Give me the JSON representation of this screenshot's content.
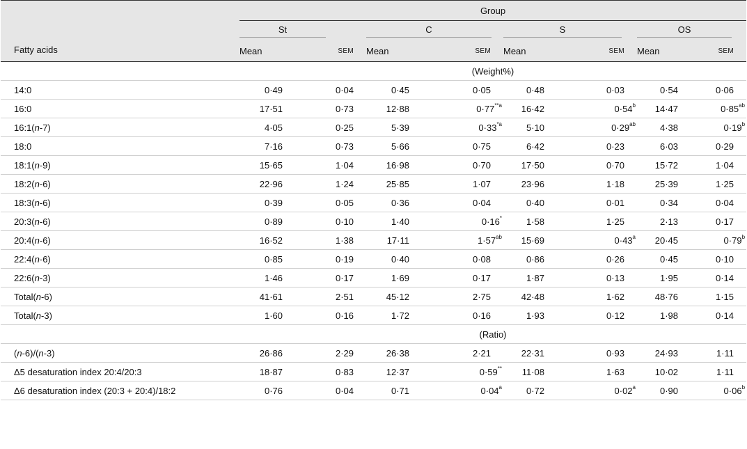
{
  "header": {
    "group_label": "Group",
    "row_label": "Fatty acids",
    "groups": [
      "St",
      "C",
      "S",
      "OS"
    ],
    "mean_label": "Mean",
    "sem_label": "SEM"
  },
  "sections": {
    "weight": "(Weight%)",
    "ratio": "(Ratio)"
  },
  "rows_weight": [
    {
      "name": "14:0",
      "values": [
        "0·49",
        "0·04",
        "0·45",
        "0·05",
        "0·48",
        "0·03",
        "0·54",
        "0·06"
      ],
      "sup": [
        "",
        "",
        "",
        "",
        "",
        "",
        "",
        ""
      ]
    },
    {
      "name": "16:0",
      "values": [
        "17·51",
        "0·73",
        "12·88",
        "0·77",
        "16·42",
        "0·54",
        "14·47",
        "0·85"
      ],
      "sup": [
        "",
        "",
        "",
        "**a",
        "",
        "b",
        "",
        "ab"
      ]
    },
    {
      "name_pre": "16:1(",
      "name_it": "n",
      "name_post": "-7)",
      "values": [
        "4·05",
        "0·25",
        "5·39",
        "0·33",
        "5·10",
        "0·29",
        "4·38",
        "0·19"
      ],
      "sup": [
        "",
        "",
        "",
        "*a",
        "",
        "ab",
        "",
        "b"
      ]
    },
    {
      "name": "18:0",
      "values": [
        "7·16",
        "0·73",
        "5·66",
        "0·75",
        "6·42",
        "0·23",
        "6·03",
        "0·29"
      ],
      "sup": [
        "",
        "",
        "",
        "",
        "",
        "",
        "",
        ""
      ]
    },
    {
      "name_pre": "18:1(",
      "name_it": "n",
      "name_post": "-9)",
      "values": [
        "15·65",
        "1·04",
        "16·98",
        "0·70",
        "17·50",
        "0·70",
        "15·72",
        "1·04"
      ],
      "sup": [
        "",
        "",
        "",
        "",
        "",
        "",
        "",
        ""
      ]
    },
    {
      "name_pre": "18:2(",
      "name_it": "n",
      "name_post": "-6)",
      "values": [
        "22·96",
        "1·24",
        "25·85",
        "1·07",
        "23·96",
        "1·18",
        "25·39",
        "1·25"
      ],
      "sup": [
        "",
        "",
        "",
        "",
        "",
        "",
        "",
        ""
      ]
    },
    {
      "name_pre": "18:3(",
      "name_it": "n",
      "name_post": "-6)",
      "values": [
        "0·39",
        "0·05",
        "0·36",
        "0·04",
        "0·40",
        "0·01",
        "0·34",
        "0·04"
      ],
      "sup": [
        "",
        "",
        "",
        "",
        "",
        "",
        "",
        ""
      ]
    },
    {
      "name_pre": "20:3(",
      "name_it": "n",
      "name_post": "-6)",
      "values": [
        "0·89",
        "0·10",
        "1·40",
        "0·16",
        "1·58",
        "1·25",
        "2·13",
        "0·17"
      ],
      "sup": [
        "",
        "",
        "",
        "*",
        "",
        "",
        "",
        ""
      ]
    },
    {
      "name_pre": "20:4(",
      "name_it": "n",
      "name_post": "-6)",
      "values": [
        "16·52",
        "1·38",
        "17·11",
        "1·57",
        "15·69",
        "0·43",
        "20·45",
        "0·79"
      ],
      "sup": [
        "",
        "",
        "",
        "ab",
        "",
        "a",
        "",
        "b"
      ]
    },
    {
      "name_pre": "22:4(",
      "name_it": "n",
      "name_post": "-6)",
      "values": [
        "0·85",
        "0·19",
        "0·40",
        "0·08",
        "0·86",
        "0·26",
        "0·45",
        "0·10"
      ],
      "sup": [
        "",
        "",
        "",
        "",
        "",
        "",
        "",
        ""
      ]
    },
    {
      "name_pre": "22:6(",
      "name_it": "n",
      "name_post": "-3)",
      "values": [
        "1·46",
        "0·17",
        "1·69",
        "0·17",
        "1·87",
        "0·13",
        "1·95",
        "0·14"
      ],
      "sup": [
        "",
        "",
        "",
        "",
        "",
        "",
        "",
        ""
      ]
    },
    {
      "name_pre": "Total(",
      "name_it": "n",
      "name_post": "-6)",
      "values": [
        "41·61",
        "2·51",
        "45·12",
        "2·75",
        "42·48",
        "1·62",
        "48·76",
        "1·15"
      ],
      "sup": [
        "",
        "",
        "",
        "",
        "",
        "",
        "",
        ""
      ]
    },
    {
      "name_pre": "Total(",
      "name_it": "n",
      "name_post": "-3)",
      "values": [
        "1·60",
        "0·16",
        "1·72",
        "0·16",
        "1·93",
        "0·12",
        "1·98",
        "0·14"
      ],
      "sup": [
        "",
        "",
        "",
        "",
        "",
        "",
        "",
        ""
      ]
    }
  ],
  "rows_ratio": [
    {
      "name_html": "ratio",
      "name_pre": "(",
      "name_it": "n",
      "name_post": "-6)/(",
      "name_it2": "n",
      "name_post2": "-3)",
      "values": [
        "26·86",
        "2·29",
        "26·38",
        "2·21",
        "22·31",
        "0·93",
        "24·93",
        "1·11"
      ],
      "sup": [
        "",
        "",
        "",
        "",
        "",
        "",
        "",
        ""
      ]
    },
    {
      "name": "Δ5 desaturation index 20:4/20:3",
      "values": [
        "18·87",
        "0·83",
        "12·37",
        "0·59",
        "11·08",
        "1·63",
        "10·02",
        "1·11"
      ],
      "sup": [
        "",
        "",
        "",
        "**",
        "",
        "",
        "",
        ""
      ]
    },
    {
      "name": "Δ6 desaturation index (20:3 + 20:4)/18:2",
      "values": [
        "0·76",
        "0·04",
        "0·71",
        "0·04",
        "0·72",
        "0·02",
        "0·90",
        "0·06"
      ],
      "sup": [
        "",
        "",
        "",
        "a",
        "",
        "a",
        "",
        "b"
      ]
    }
  ]
}
